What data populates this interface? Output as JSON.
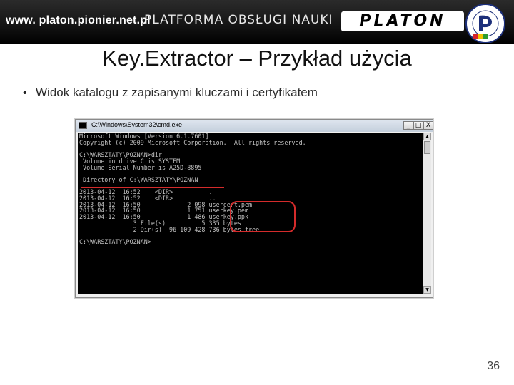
{
  "header": {
    "url": "www. platon.pionier.net.pl",
    "platform": "PLATFORMA OBSŁUGI NAUKI",
    "logo": "PLATON",
    "seal_text": "POLSKI INTERNET OPTYCZNY"
  },
  "slide": {
    "title": "Key.Extractor – Przykład użycia",
    "bullet": "Widok katalogu z zapisanymi kluczami i certyfikatem",
    "bullet_symbol": "•",
    "page_number": "36"
  },
  "window": {
    "title": "C:\\Windows\\System32\\cmd.exe",
    "minimize": "_",
    "maximize": "□",
    "close": "X"
  },
  "console": {
    "lines": [
      "Microsoft Windows [Version 6.1.7601]",
      "Copyright (c) 2009 Microsoft Corporation.  All rights reserved.",
      "",
      "C:\\WARSZTATY\\POZNAN>dir",
      " Volume in drive C is SYSTEM",
      " Volume Serial Number is A25D-8895",
      "",
      " Directory of C:\\WARSZTATY\\POZNAN",
      "",
      "2013-04-12  16:52    <DIR>          .",
      "2013-04-12  16:52    <DIR>          ..",
      "2013-04-12  16:50             2 098 usercert.pem",
      "2013-04-12  16:50             1 751 userkey.pem",
      "2013-04-12  16:50             1 486 userkey.ppk",
      "               3 File(s)          5 335 bytes",
      "               2 Dir(s)  96 109 428 736 bytes free",
      "",
      "C:\\WARSZTATY\\POZNAN>_"
    ]
  },
  "colors": {
    "banner": "#000000",
    "highlight": "#d42b2b",
    "console_bg": "#000000",
    "console_text": "#c0c0c0"
  }
}
